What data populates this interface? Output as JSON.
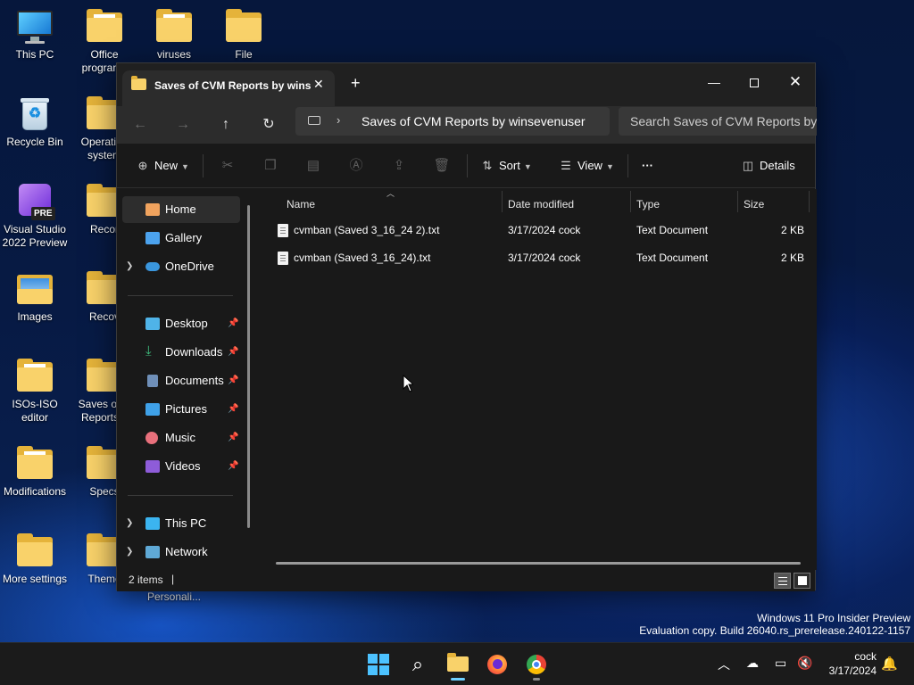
{
  "desktop": {
    "icons": [
      {
        "label": "This PC"
      },
      {
        "label": "Office programs"
      },
      {
        "label": "viruses"
      },
      {
        "label": "File"
      },
      {
        "label": "Recycle Bin"
      },
      {
        "label": "Operating system"
      },
      {
        "label": "Visual Studio 2022 Preview"
      },
      {
        "label": "Recor"
      },
      {
        "label": "Images"
      },
      {
        "label": "Recov"
      },
      {
        "label": "ISOs-ISO editor"
      },
      {
        "label": "Saves of C Reports b"
      },
      {
        "label": "Modifications"
      },
      {
        "label": "Specs"
      },
      {
        "label": "More settings"
      },
      {
        "label": "Theme"
      },
      {
        "label": "Personali..."
      }
    ],
    "vs_badge": "PRE"
  },
  "window": {
    "tab_title": "Saves of CVM Reports by wins",
    "tab_close": "✕",
    "new_tab": "+",
    "minimize": "—",
    "close": "✕",
    "nav": {
      "back": "←",
      "forward": "→",
      "up": "↑",
      "refresh": "↻"
    },
    "address_chevron": "›",
    "address_path": "Saves of CVM Reports by winsevenuser",
    "search_placeholder": "Search Saves of CVM Reports by winsevenuser",
    "toolbar": {
      "new_label": "New",
      "sort_label": "Sort",
      "view_label": "View",
      "more_label": "···",
      "details_label": "Details"
    },
    "sidebar": {
      "home": "Home",
      "gallery": "Gallery",
      "onedrive": "OneDrive",
      "desktop": "Desktop",
      "downloads": "Downloads",
      "documents": "Documents",
      "pictures": "Pictures",
      "music": "Music",
      "videos": "Videos",
      "this_pc": "This PC",
      "network": "Network"
    },
    "columns": {
      "name": "Name",
      "date": "Date modified",
      "type": "Type",
      "size": "Size"
    },
    "files": [
      {
        "name": "cvmban (Saved 3_16_24 2).txt",
        "date": "3/17/2024  cock",
        "type": "Text Document",
        "size": "2 KB"
      },
      {
        "name": "cvmban (Saved 3_16_24).txt",
        "date": "3/17/2024  cock",
        "type": "Text Document",
        "size": "2 KB"
      }
    ],
    "status": "2 items",
    "status_caret": "|"
  },
  "watermark": {
    "line1": "Windows 11 Pro Insider Preview",
    "line2": "Evaluation copy. Build 26040.rs_prerelease.240122-1157"
  },
  "taskbar": {
    "search_glyph": "⌕",
    "tray_chevron": "︿",
    "clock_time": "cock",
    "clock_date": "3/17/2024"
  }
}
